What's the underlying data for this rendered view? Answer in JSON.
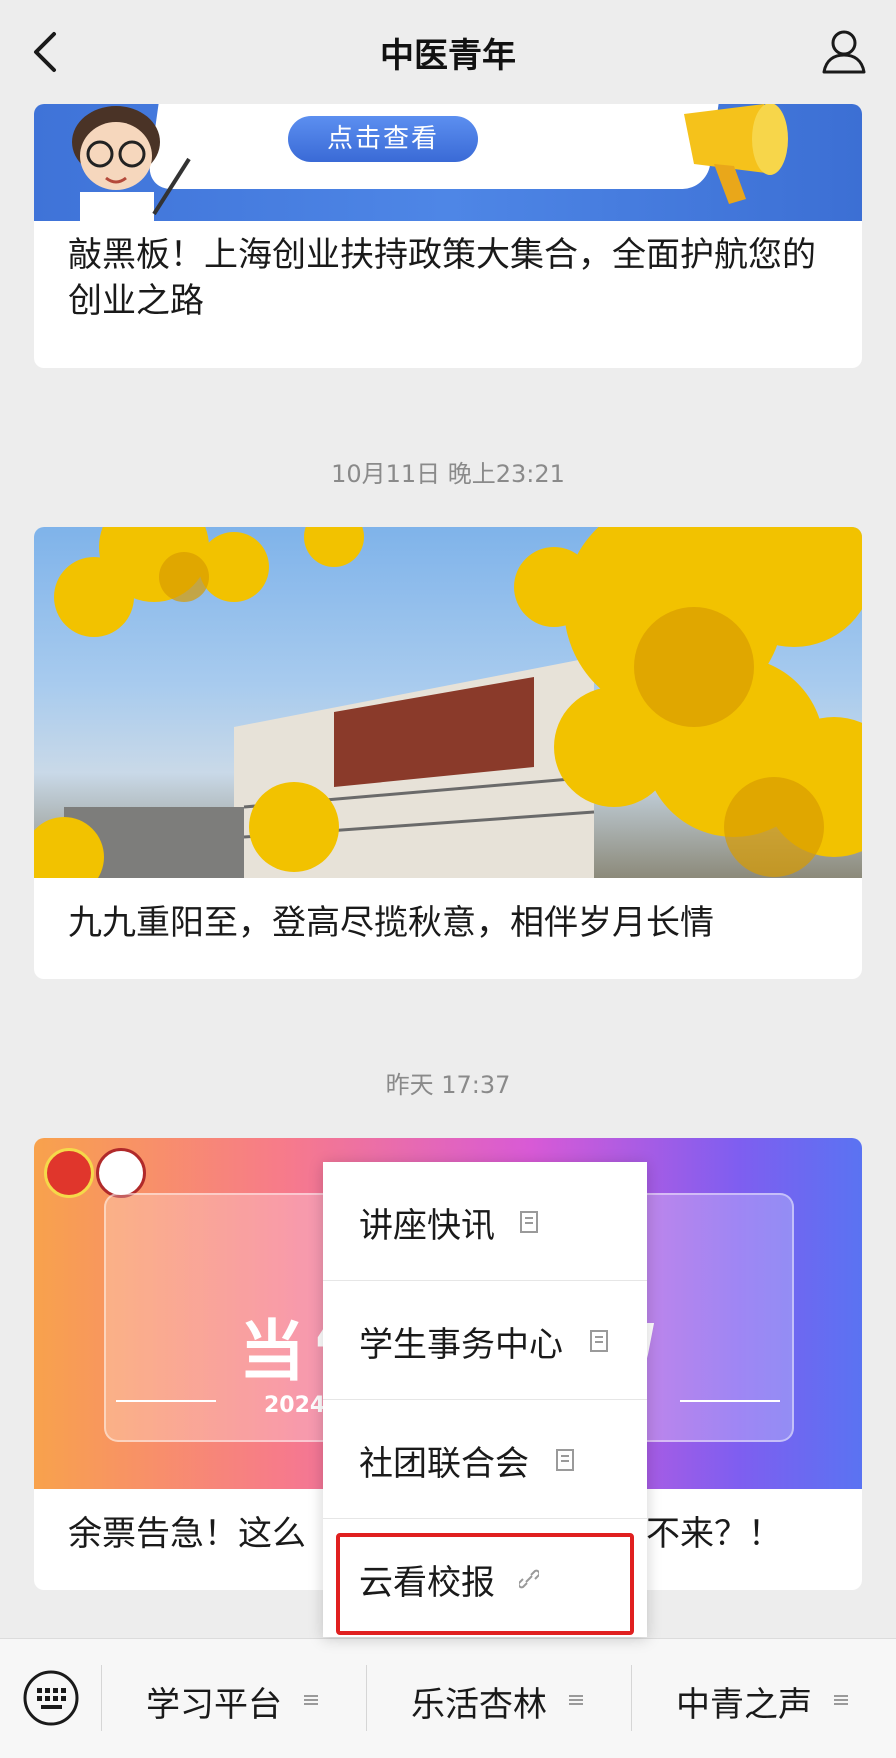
{
  "header": {
    "title": "中医青年",
    "back_icon": "chevron-left-icon",
    "profile_icon": "person-icon"
  },
  "feed": {
    "article1": {
      "banner_button": "点击查看",
      "title": "敲黑板！上海创业扶持政策大集合，全面护航您的创业之路"
    },
    "timestamp2": "10月11日 晚上23:21",
    "article2": {
      "title": "九九重阳至，登高尽揽秋意，相伴岁月长情"
    },
    "timestamp3": "昨天 17:37",
    "article3": {
      "banner_text": "当“",
      "banner_tail": "g",
      "banner_year": "2024",
      "title_left": "余票告急！这么",
      "title_right": "不来？！"
    }
  },
  "popup_menu": {
    "items": [
      {
        "label": "讲座快讯",
        "icon": "document-icon"
      },
      {
        "label": "学生事务中心",
        "icon": "document-icon"
      },
      {
        "label": "社团联合会",
        "icon": "document-icon"
      },
      {
        "label": "云看校报",
        "icon": "link-icon"
      }
    ],
    "highlighted_index": 3
  },
  "bottom_bar": {
    "keyboard_icon": "keyboard-icon",
    "tabs": [
      {
        "label": "学习平台",
        "icon": "menu-icon"
      },
      {
        "label": "乐活杏林",
        "icon": "menu-icon"
      },
      {
        "label": "中青之声",
        "icon": "menu-icon"
      }
    ]
  },
  "colors": {
    "background": "#ededed",
    "highlight_border": "#e02020"
  }
}
